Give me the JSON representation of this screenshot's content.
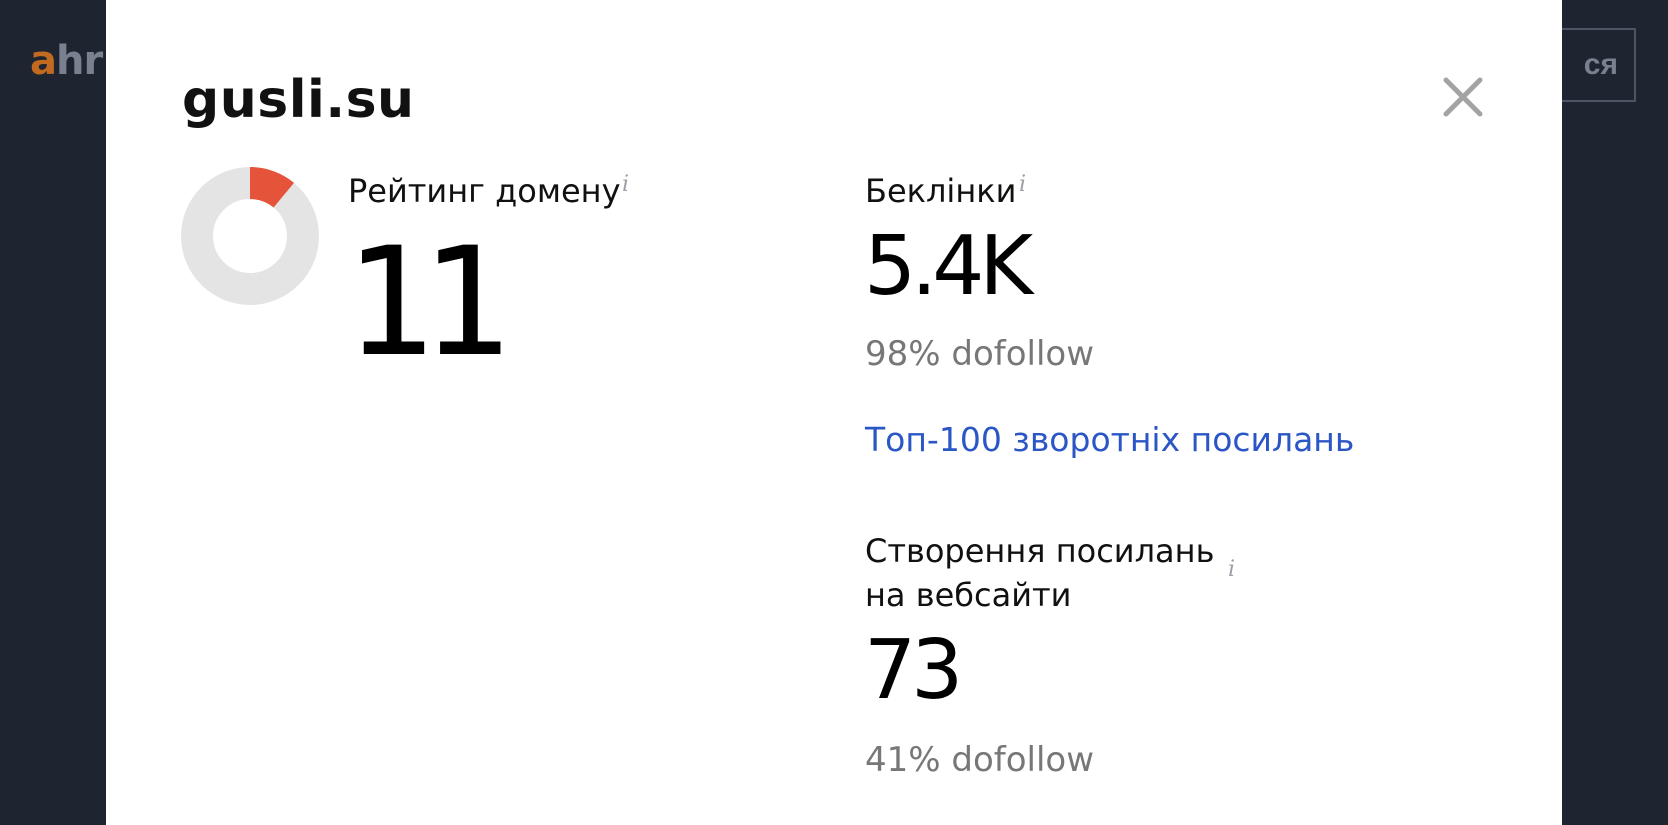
{
  "background": {
    "logo_accent": "a",
    "logo_rest": "hr",
    "login_fragment": "ся"
  },
  "modal": {
    "domain": "gusli.su",
    "close_label": "×",
    "domain_rating": {
      "label": "Рейтинг домену",
      "info": "i",
      "value": "11",
      "fraction": 0.11,
      "ring_color": "#e4e4e4",
      "fill_color": "#e5533a"
    },
    "backlinks": {
      "label": "Беклінки",
      "info": "i",
      "value": "5.4K",
      "dofollow": "98% dofollow",
      "top_link": "Топ-100 зворотніх посилань"
    },
    "linking_websites": {
      "label_line1": "Створення посилань",
      "label_line2": "на вебсайти",
      "info": "i",
      "value": "73",
      "dofollow": "41% dofollow"
    }
  },
  "colors": {
    "backdrop": "#1e2430",
    "link": "#2b56c5",
    "muted": "#777777",
    "accent": "#c26a1f"
  }
}
